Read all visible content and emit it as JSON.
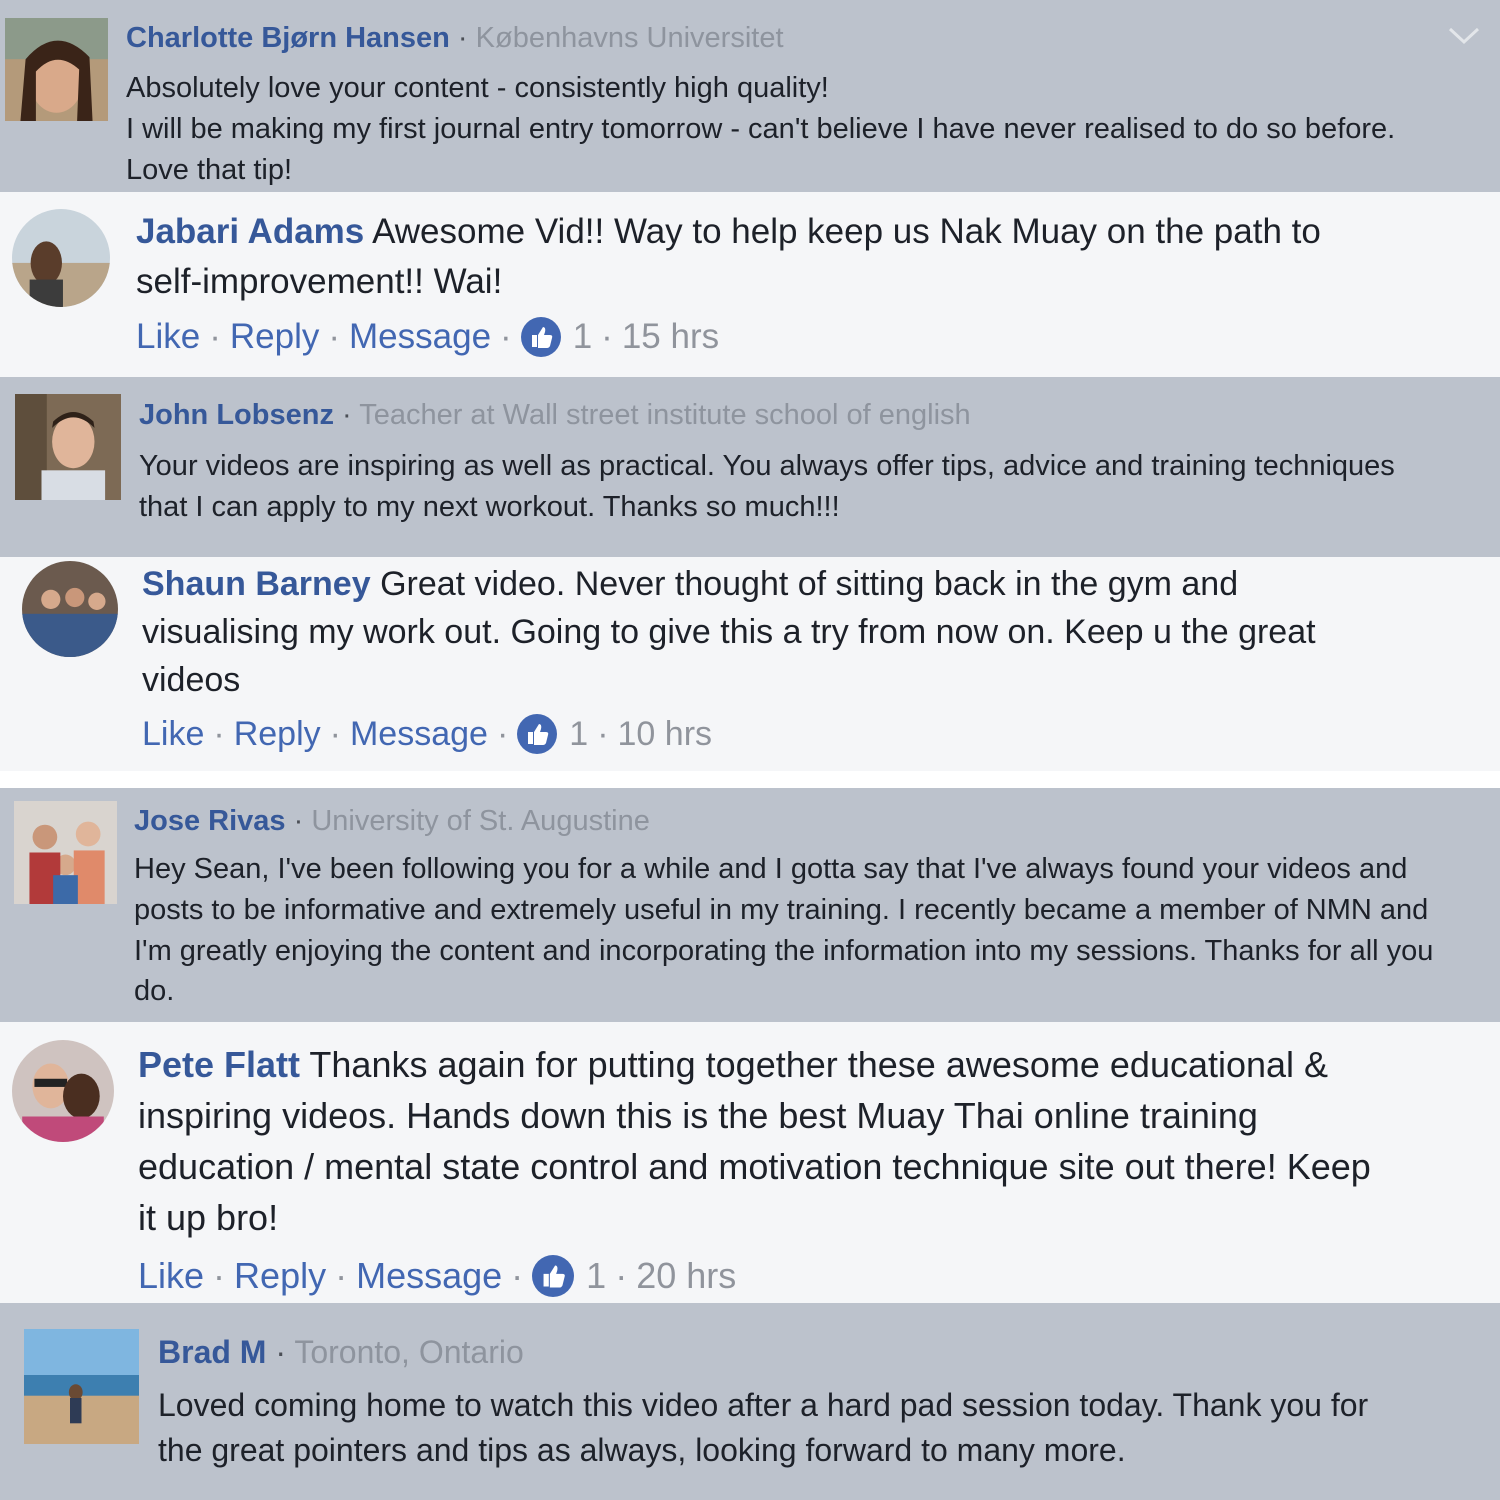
{
  "colors": {
    "name_link": "#365899",
    "action_link": "#4267b2",
    "muted": "#90949c",
    "gray_panel": "#bcc2cc",
    "light_panel": "#f5f6f8"
  },
  "comments": [
    {
      "name": "Charlotte Bjørn Hansen",
      "affiliation": "Københavns Universitet",
      "lines": [
        "Absolutely love your content - consistently high quality!",
        "I will be making my first journal entry tomorrow - can't believe I have never realised to do so before.",
        "Love that tip!"
      ],
      "menu_icon": "chevron-down-icon"
    },
    {
      "name": "Jabari Adams",
      "lines": [
        "Awesome Vid!! Way to help keep us Nak Muay on the path to",
        "self-improvement!! Wai!"
      ],
      "actions": {
        "like": "Like",
        "reply": "Reply",
        "message": "Message",
        "reactions": "1",
        "time": "15 hrs"
      }
    },
    {
      "name": "John Lobsenz",
      "affiliation": "Teacher at Wall street institute school of english",
      "lines": [
        "Your videos are inspiring as well as practical. You always offer tips, advice and training techniques",
        "that I can apply to my next workout. Thanks so much!!!"
      ]
    },
    {
      "name": "Shaun Barney",
      "lines": [
        "Great video. Never thought of sitting back in the gym and",
        "visualising my work out. Going to give this a try from now on. Keep u the great",
        "videos"
      ],
      "actions": {
        "like": "Like",
        "reply": "Reply",
        "message": "Message",
        "reactions": "1",
        "time": "10 hrs"
      }
    },
    {
      "name": "Jose Rivas",
      "affiliation": "University of St. Augustine",
      "lines": [
        "Hey Sean, I've been following you for a while and I gotta say that I've always found your videos and",
        "posts to be informative and extremely useful in my training. I recently became a member of NMN and",
        "I'm greatly enjoying the content and incorporating the information into my sessions. Thanks for all you",
        "do."
      ]
    },
    {
      "name": "Pete Flatt",
      "lines": [
        "Thanks again for putting together these awesome educational &",
        "inspiring videos. Hands down this is the best Muay Thai online training",
        "education / mental state control and motivation technique site out there! Keep",
        "it up bro!"
      ],
      "actions": {
        "like": "Like",
        "reply": "Reply",
        "message": "Message",
        "reactions": "1",
        "time": "20 hrs"
      }
    },
    {
      "name": "Brad M",
      "affiliation": "Toronto, Ontario",
      "lines": [
        "Loved coming home to watch this video after a hard pad session today. Thank you for",
        "the great pointers and tips as always, looking forward to many more."
      ]
    }
  ]
}
